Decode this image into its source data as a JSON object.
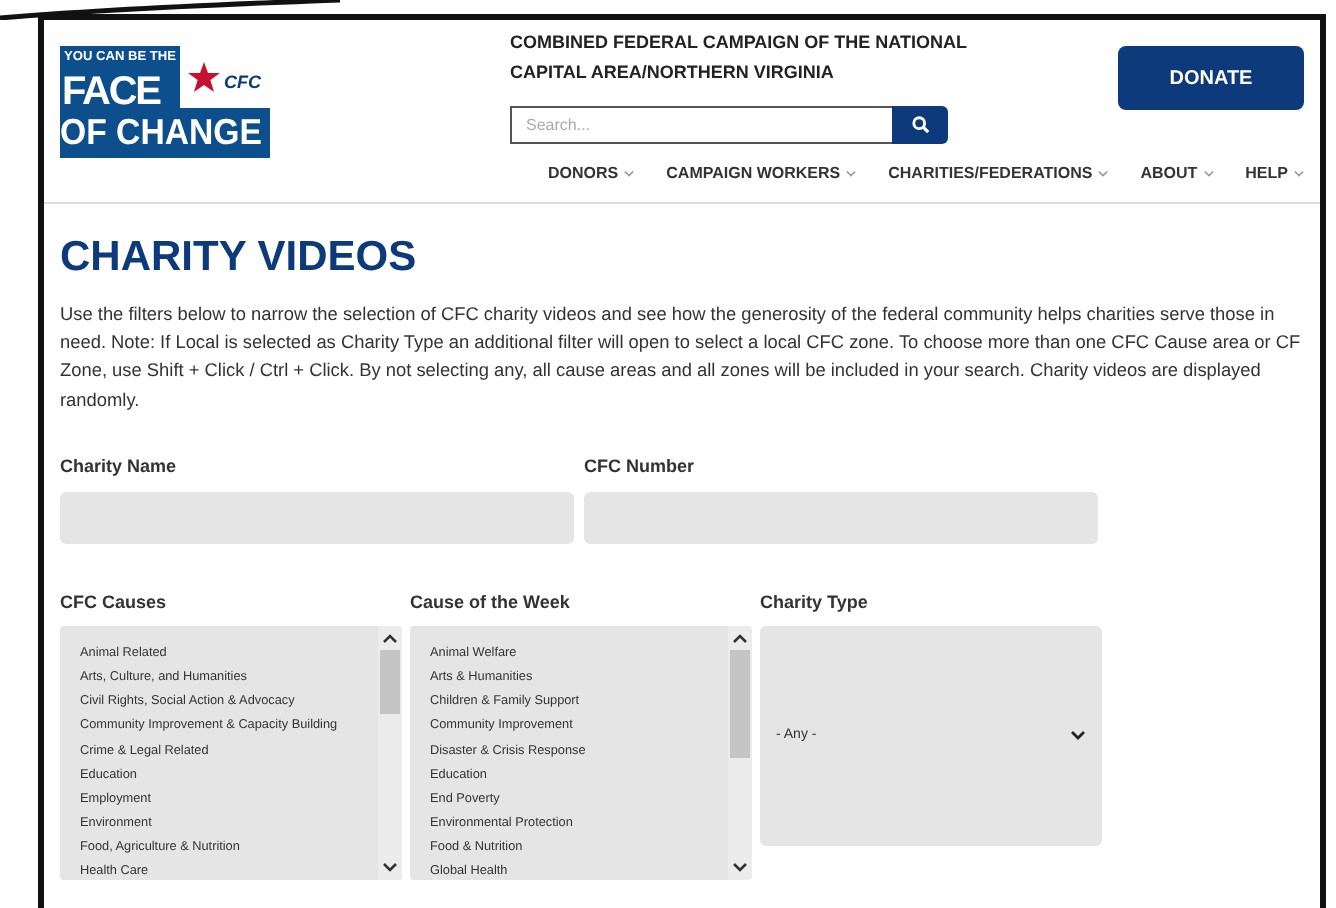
{
  "logo": {
    "tagline": "YOU CAN BE THE",
    "line1": "FACE",
    "line2": "OF CHANGE",
    "mark": "CFC"
  },
  "header": {
    "title_lines": [
      "COMBINED FEDERAL CAMPAIGN OF THE NATIONAL",
      "CAPITAL AREA/NORTHERN VIRGINIA"
    ],
    "search": {
      "placeholder": "Search..."
    },
    "donate": "DONATE"
  },
  "nav": [
    {
      "label": "DONORS"
    },
    {
      "label": "CAMPAIGN WORKERS"
    },
    {
      "label": "CHARITIES/FEDERATIONS"
    },
    {
      "label": "ABOUT"
    },
    {
      "label": "HELP"
    }
  ],
  "heading": "CHARITY VIDEOS",
  "intro_lines": [
    "Use the filters below to narrow the selection of CFC charity videos and see how the generosity of the federal community helps charities serve those in",
    "need. Note: If Local is selected as Charity Type an additional filter will open to select a local CFC zone. To choose more than one CFC Cause area or CF",
    "Zone, use Shift + Click / Ctrl + Click. By not selecting any, all cause areas and all zones will be included in your search. Charity videos are displayed",
    "randomly."
  ],
  "text_fields": [
    {
      "label": "Charity Name"
    },
    {
      "label": "CFC Number"
    }
  ],
  "filters": [
    {
      "kind": "listbox",
      "label": "CFC Causes",
      "items": [
        "Animal Related",
        "Arts, Culture, and Humanities",
        "Civil Rights, Social Action & Advocacy",
        "Community Improvement & Capacity Building",
        "Crime & Legal Related",
        "Education",
        "Employment",
        "Environment",
        "Food, Agriculture & Nutrition",
        "Health Care"
      ]
    },
    {
      "kind": "listbox",
      "label": "Cause of the Week",
      "items": [
        "Animal Welfare",
        "Arts & Humanities",
        "Children & Family Support",
        "Community Improvement",
        "Disaster & Crisis Response",
        "Education",
        "End Poverty",
        "Environmental Protection",
        "Food & Nutrition",
        "Global Health"
      ]
    },
    {
      "kind": "dropdown",
      "label": "Charity Type",
      "value": "- Any -"
    }
  ]
}
